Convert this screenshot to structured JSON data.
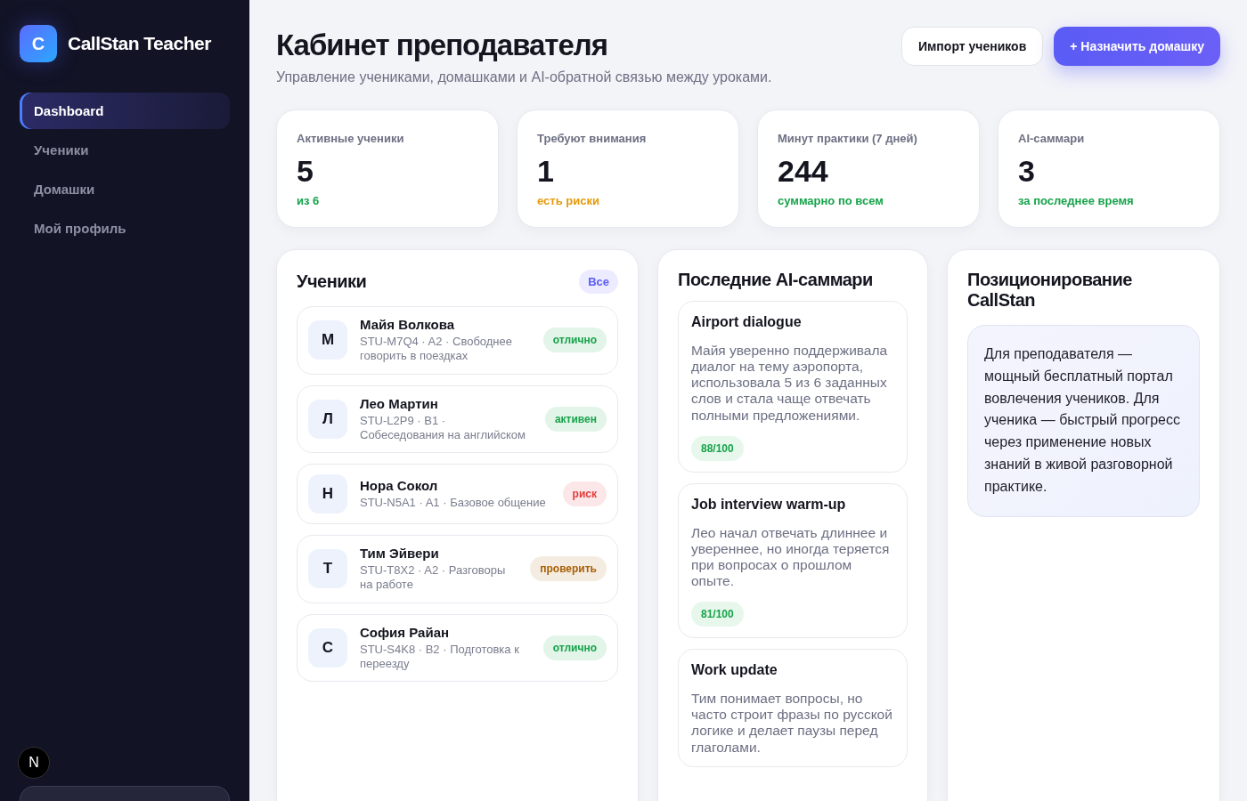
{
  "sidebar": {
    "logo_letter": "C",
    "brand": "CallStan Teacher",
    "items": [
      {
        "label": "Dashboard",
        "selected": true
      },
      {
        "label": "Ученики",
        "selected": false
      },
      {
        "label": "Домашки",
        "selected": false
      },
      {
        "label": "Мой профиль",
        "selected": false
      }
    ],
    "dev_badge": "N"
  },
  "header": {
    "title": "Кабинет преподавателя",
    "subtitle": "Управление учениками, домашками и AI-обратной связью между уроками.",
    "buttons": [
      {
        "label": "Импорт учеников",
        "kind": "secondary"
      },
      {
        "label": "+ Назначить домашку",
        "kind": "primary"
      }
    ]
  },
  "stats": [
    {
      "label": "Активные ученики",
      "value": "5",
      "note": "из 6",
      "color": "#16a34a"
    },
    {
      "label": "Требуют внимания",
      "value": "1",
      "note": "есть риски",
      "color": "#e59a0b"
    },
    {
      "label": "Минут практики (7 дней)",
      "value": "244",
      "note": "суммарно по всем",
      "color": "#16a34a"
    },
    {
      "label": "AI-саммари",
      "value": "3",
      "note": "за последнее время",
      "color": "#16a34a"
    }
  ],
  "students": {
    "title": "Ученики",
    "filter": "Все",
    "rows": [
      {
        "initial": "М",
        "name": "Майя Волкова",
        "meta": "STU-M7Q4 · A2 · Свободнее говорить в поездках",
        "status": "отлично",
        "color": "#16a34a"
      },
      {
        "initial": "Л",
        "name": "Лео Мартин",
        "meta": "STU-L2P9 · B1 · Собеседования на английском",
        "status": "активен",
        "color": "#16a34a"
      },
      {
        "initial": "Н",
        "name": "Нора Сокол",
        "meta": "STU-N5A1 · A1 · Базовое общение",
        "status": "риск",
        "color": "#e23b3b"
      },
      {
        "initial": "Т",
        "name": "Тим Эйвери",
        "meta": "STU-T8X2 · A2 · Разговоры на работе",
        "status": "проверить",
        "color": "#a85f05"
      },
      {
        "initial": "С",
        "name": "София Райан",
        "meta": "STU-S4K8 · B2 · Подготовка к переезду",
        "status": "отлично",
        "color": "#16a34a"
      }
    ]
  },
  "summaries": {
    "title": "Последние AI-саммари",
    "items": [
      {
        "title": "Airport dialogue",
        "text": "Майя уверенно поддерживала диалог на тему аэропорта, использовала 5 из 6 заданных слов и стала чаще отвечать полными предложениями.",
        "score": "88/100"
      },
      {
        "title": "Job interview warm-up",
        "text": "Лео начал отвечать длиннее и увереннее, но иногда теряется при вопросах о прошлом опыте.",
        "score": "81/100"
      },
      {
        "title": "Work update",
        "text": "Тим понимает вопросы, но часто строит фразы по русской логике и делает паузы перед глаголами."
      }
    ]
  },
  "positioning": {
    "title": "Позиционирование CallStan",
    "text": "Для преподавателя — мощный бесплатный портал вовлечения учеников. Для ученика — быстрый прогресс через применение новых знаний в живой разговорной практике."
  }
}
